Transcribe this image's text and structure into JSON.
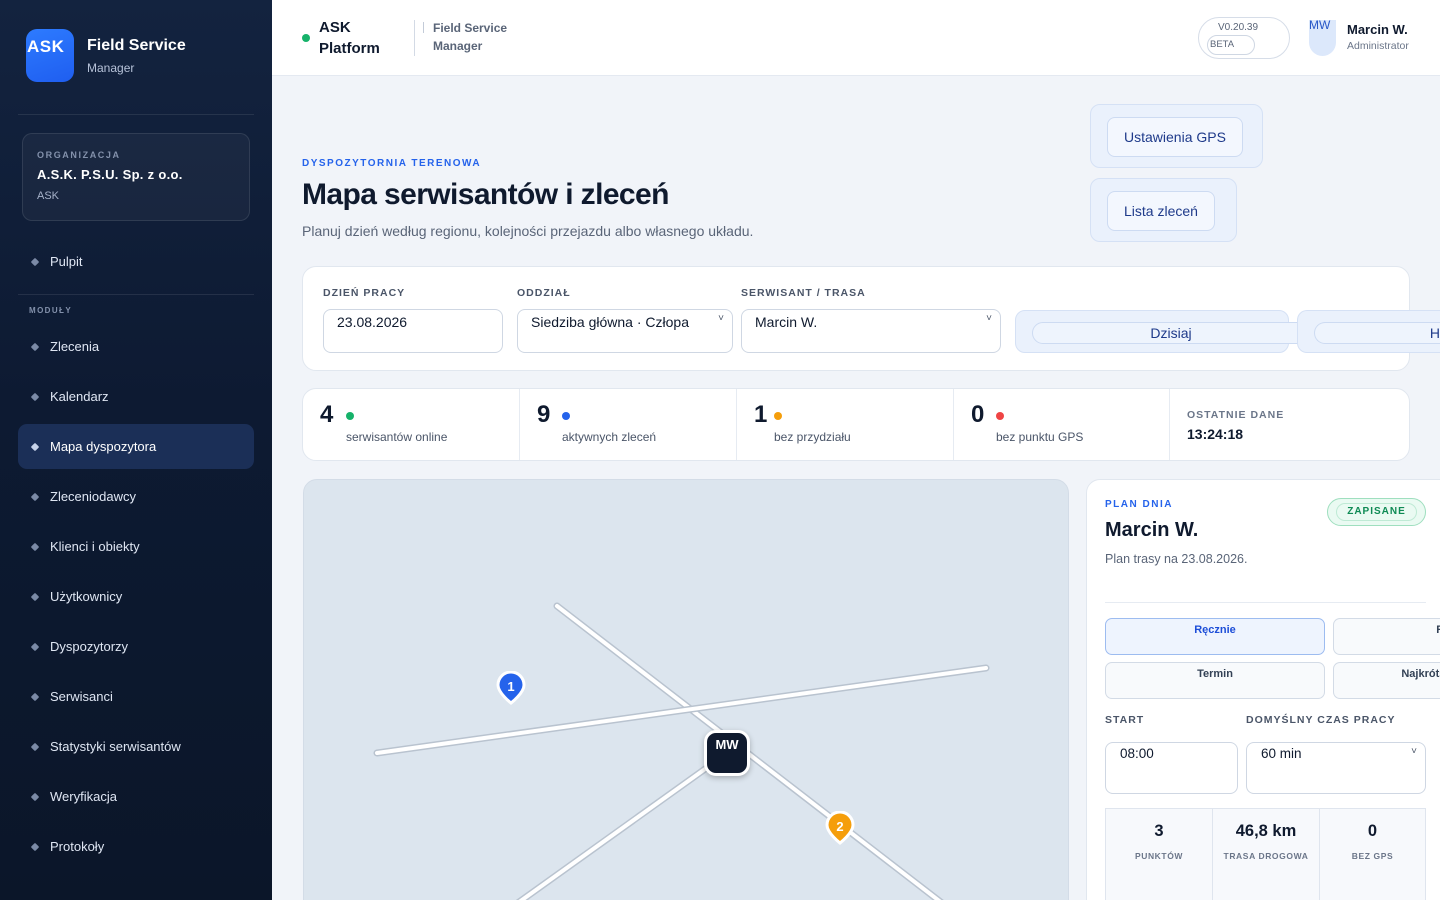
{
  "brand": {
    "logo": "ASK",
    "title": "Field Service",
    "subtitle": "Manager"
  },
  "org": {
    "label": "ORGANIZACJA",
    "name": "A.S.K. P.S.U. Sp. z o.o.",
    "code": "ASK"
  },
  "nav": {
    "top": "Pulpit",
    "section": "MODUŁY",
    "items": [
      "Zlecenia",
      "Kalendarz",
      "Mapa dyspozytora",
      "Zleceniodawcy",
      "Klienci i obiekty",
      "Użytkownicy",
      "Dyspozytorzy",
      "Serwisanci",
      "Statystyki serwisantów",
      "Weryfikacja",
      "Protokoły"
    ],
    "active": "Mapa dyspozytora"
  },
  "topbar": {
    "platform": "ASK Platform",
    "product": "Field Service Manager",
    "version": "V0.20.39",
    "beta": "BETA",
    "user": {
      "initials": "MW",
      "name": "Marcin W.",
      "role": "Administrator"
    }
  },
  "header": {
    "eyebrow": "DYSPOZYTORNIA TERENOWA",
    "title": "Mapa serwisantów i zleceń",
    "description": "Planuj dzień według regionu, kolejności przejazdu albo własnego układu.",
    "buttons": {
      "gps": "Ustawienia GPS",
      "orders": "Lista zleceń"
    }
  },
  "filters": {
    "day": {
      "label": "DZIEŃ PRACY",
      "value": "23.08.2026"
    },
    "branch": {
      "label": "ODDZIAŁ",
      "value": "Siedziba główna · Człopa"
    },
    "tech": {
      "label": "SERWISANT / TRASA",
      "value": "Marcin W."
    },
    "today": "Dzisiaj",
    "history": "Hist"
  },
  "stats": [
    {
      "value": "4",
      "label": "serwisantów online",
      "color": "#16b26a"
    },
    {
      "value": "9",
      "label": "aktywnych zleceń",
      "color": "#2563eb"
    },
    {
      "value": "1",
      "label": "bez przydziału",
      "color": "#f59e0b"
    },
    {
      "value": "0",
      "label": "bez punktu GPS",
      "color": "#ef4444"
    }
  ],
  "last_data": {
    "label": "OSTATNIE DANE",
    "time": "13:24:18"
  },
  "map": {
    "tech_marker": "MW",
    "pins": [
      {
        "label": "1",
        "color": "#2563eb"
      },
      {
        "label": "2",
        "color": "#f59e0b"
      }
    ]
  },
  "plan": {
    "eyebrow": "PLAN DNIA",
    "name": "Marcin W.",
    "description": "Plan trasy na 23.08.2026.",
    "badge": "ZAPISANE",
    "modes": [
      "Ręcznie",
      "Reg",
      "Termin",
      "Najkrótsza"
    ],
    "start_label": "START",
    "start_value": "08:00",
    "duration_label": "DOMYŚLNY CZAS PRACY",
    "duration_value": "60 min",
    "summary": [
      {
        "value": "3",
        "label": "PUNKTÓW"
      },
      {
        "value": "46,8 km",
        "label": "TRASA DROGOWA"
      },
      {
        "value": "0",
        "label": "BEZ GPS"
      }
    ]
  },
  "icons": {
    "nav_bullet": "diamond-icon",
    "select": "chevron-down-icon"
  }
}
